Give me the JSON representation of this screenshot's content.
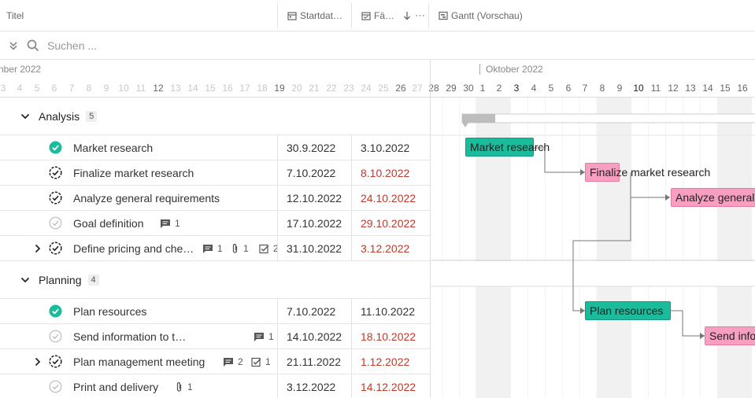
{
  "header": {
    "col_title": "Titel",
    "col_start": "Startdat…",
    "col_due": "Fä…",
    "col_gantt": "Gantt (Vorschau)"
  },
  "search": {
    "placeholder": "Suchen ..."
  },
  "ruler": {
    "month_left": "nber 2022",
    "month_right": "Oktober 2022",
    "days_left": [
      "3",
      "4",
      "5",
      "6",
      "7",
      "8",
      "9",
      "10",
      "11",
      "12",
      "13",
      "14",
      "15",
      "16",
      "17",
      "18",
      "19",
      "20",
      "21",
      "22",
      "23",
      "24",
      "25",
      "26",
      "27"
    ],
    "days_gantt": [
      "28",
      "29",
      "30",
      "1",
      "2",
      "3",
      "4",
      "5",
      "6",
      "7",
      "8",
      "9",
      "10",
      "11",
      "12",
      "13",
      "14",
      "15",
      "16"
    ]
  },
  "groups": [
    {
      "label": "Analysis",
      "count": "5",
      "tasks": [
        {
          "title": "Market research",
          "start": "30.9.2022",
          "due": "3.10.2022",
          "due_overdue": false,
          "status": "done",
          "expandable": false,
          "comments": "",
          "attachments": "",
          "checklist": ""
        },
        {
          "title": "Finalize market research",
          "start": "7.10.2022",
          "due": "8.10.2022",
          "due_overdue": true,
          "status": "progress",
          "expandable": false,
          "comments": "",
          "attachments": "",
          "checklist": ""
        },
        {
          "title": "Analyze general requirements",
          "start": "12.10.2022",
          "due": "24.10.2022",
          "due_overdue": true,
          "status": "progress",
          "expandable": false,
          "comments": "",
          "attachments": "",
          "checklist": ""
        },
        {
          "title": "Goal definition",
          "start": "17.10.2022",
          "due": "29.10.2022",
          "due_overdue": true,
          "status": "open",
          "expandable": false,
          "comments": "1",
          "attachments": "",
          "checklist": ""
        },
        {
          "title": "Define pricing and che…",
          "start": "31.10.2022",
          "due": "3.12.2022",
          "due_overdue": true,
          "status": "progress",
          "expandable": true,
          "comments": "1",
          "attachments": "1",
          "checklist": "2"
        }
      ]
    },
    {
      "label": "Planning",
      "count": "4",
      "tasks": [
        {
          "title": "Plan resources",
          "start": "7.10.2022",
          "due": "11.10.2022",
          "due_overdue": false,
          "status": "done",
          "expandable": false,
          "comments": "",
          "attachments": "",
          "checklist": ""
        },
        {
          "title": "Send information to team memb…",
          "start": "14.10.2022",
          "due": "18.10.2022",
          "due_overdue": true,
          "status": "open",
          "expandable": false,
          "comments": "1",
          "attachments": "",
          "checklist": ""
        },
        {
          "title": "Plan management meeting",
          "start": "21.11.2022",
          "due": "1.12.2022",
          "due_overdue": true,
          "status": "progress",
          "expandable": true,
          "comments": "2",
          "attachments": "",
          "checklist": "1"
        },
        {
          "title": "Print and delivery",
          "start": "3.12.2022",
          "due": "14.12.2022",
          "due_overdue": true,
          "status": "open",
          "expandable": false,
          "comments": "",
          "attachments": "1",
          "checklist": ""
        }
      ]
    }
  ],
  "gantt_bars": {
    "market_research": "Market research",
    "finalize": "Finalize market research",
    "analyze": "Analyze general",
    "plan_resources": "Plan resources",
    "send_info": "Send info"
  },
  "colors": {
    "done_green": "#1abc9c",
    "overdue_red": "#c0392b",
    "bar_pink": "#f79fc0"
  }
}
